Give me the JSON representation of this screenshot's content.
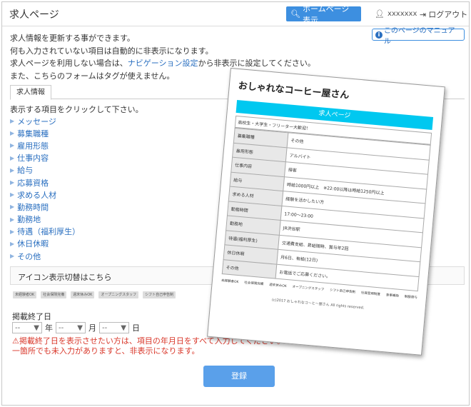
{
  "header": {
    "title": "求人ページ",
    "home_button": "ホームページ表示",
    "user": "xxxxxxx",
    "logout": "ログアウト",
    "manual": "このページのマニュアル"
  },
  "description": {
    "line1": "求人情報を更新する事ができます。",
    "line2": "何も入力されていない項目は自動的に非表示になります。",
    "line3_prefix": "求人ページを利用しない場合は、",
    "line3_link": "ナビゲーション設定",
    "line3_suffix": "から非表示に設定してください。",
    "line4": "また、こちらのフォームはタグが使えません。"
  },
  "tab": "求人情報",
  "instruction": "表示する項目をクリックして下さい。",
  "items": [
    "メッセージ",
    "募集職種",
    "雇用形態",
    "仕事内容",
    "給与",
    "応募資格",
    "求める人材",
    "勤務時間",
    "勤務地",
    "待遇（福利厚生）",
    "休日休暇",
    "その他"
  ],
  "icon_section": "アイコン表示切替はこちら",
  "badges": [
    "未経験者OK",
    "社会保険完備",
    "週末休みOK",
    "オープニングスタッフ",
    "シフト自己申告制"
  ],
  "date": {
    "label": "掲載終了日",
    "placeholder": "--",
    "year": "年",
    "month": "月",
    "day": "日"
  },
  "warning": {
    "line1": "掲載終了日を表示させたい方は、項目の年月日をすべて入力してください。",
    "line2": "一箇所でも未入力がありますと、非表示になります。"
  },
  "submit": "登録",
  "preview": {
    "title": "おしゃれなコーヒー屋さん",
    "banner": "求人ページ",
    "catch": "高校生・大学生・フリーター大歓迎！",
    "rows": [
      {
        "k": "募集職種",
        "v": "その他"
      },
      {
        "k": "雇用形態",
        "v": "アルバイト"
      },
      {
        "k": "仕事内容",
        "v": "接客"
      },
      {
        "k": "給与",
        "v": "時給1000円以上　※22:00以降は時給1250円以上"
      },
      {
        "k": "求める人材",
        "v": "経験を活かしたい方"
      },
      {
        "k": "勤務時間",
        "v": "17:00〜23:00"
      },
      {
        "k": "勤務地",
        "v": "JR渋谷駅"
      },
      {
        "k": "待遇(福利厚生)",
        "v": "交通費支給、昇給随時、賞与年2回"
      },
      {
        "k": "休日休暇",
        "v": "月6日、有給(12日)"
      },
      {
        "k": "その他",
        "v": "お電話でご応募ください。"
      }
    ],
    "badges": [
      "未経験者OK",
      "社会保険完備",
      "週末休みOK",
      "オープニングスタッフ",
      "シフト自己申告制",
      "社員登用制度",
      "食事補助",
      "制服貸与"
    ],
    "footer": "(c)2017 おしゃれなコーヒー屋さん All rights reserved."
  },
  "colors": {
    "accent": "#3d8fe0",
    "link": "#2a6fc0",
    "warning": "#d9372a",
    "banner": "#00c8f0"
  }
}
